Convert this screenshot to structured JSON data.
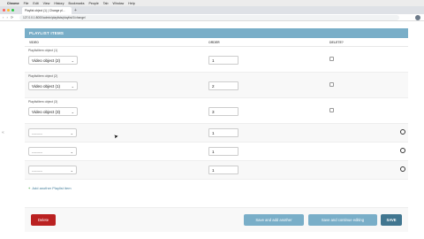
{
  "os_menubar": {
    "apple": "",
    "items": [
      "Chrome",
      "File",
      "Edit",
      "View",
      "History",
      "Bookmarks",
      "People",
      "Tab",
      "Window",
      "Help"
    ]
  },
  "browser": {
    "tab_title": "Playlist object (1) | Change pl...",
    "new_tab": "+",
    "nav": "‹ › ⟳",
    "url": "127.0.0.1:8000/admin/playlists/playlist/1/change/"
  },
  "inline": {
    "header": "PLAYLIST ITEMS",
    "columns": {
      "video": "VIDEO",
      "order": "ORDER",
      "delete": "DELETE?"
    },
    "rows": [
      {
        "label": "Playlistitem object (1)",
        "video": "Video object (2)",
        "order": "1"
      },
      {
        "label": "Playlistitem object (2)",
        "video": "Video object (1)",
        "order": "2"
      },
      {
        "label": "Playlistitem object (3)",
        "video": "Video object (3)",
        "order": "3"
      }
    ],
    "extra_rows": [
      {
        "video": "---------",
        "order": "1"
      },
      {
        "video": "---------",
        "order": "1"
      },
      {
        "video": "---------",
        "order": "1"
      }
    ],
    "chevron": "⌄",
    "add_another": "Add another Playlist item",
    "add_plus": "+"
  },
  "submit": {
    "delete": "Delete",
    "save_add_another": "Save and add another",
    "save_continue": "Save and continue editing",
    "save": "SAVE"
  },
  "colors": {
    "header": "#79aec8",
    "delete": "#ba2121",
    "save": "#417690",
    "link": "#447e9b"
  }
}
